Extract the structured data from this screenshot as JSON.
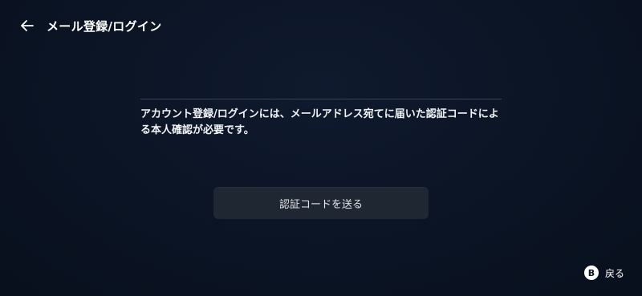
{
  "header": {
    "back_icon": "arrow-left-icon",
    "title": "メール登録/ログイン"
  },
  "main": {
    "message": "アカウント登録/ログインには、メールアドレス宛てに届いた認証コードによる本人確認が必要です。",
    "send_code_button": "認証コードを送る"
  },
  "footer": {
    "button_glyph": "B",
    "back_label": "戻る"
  }
}
